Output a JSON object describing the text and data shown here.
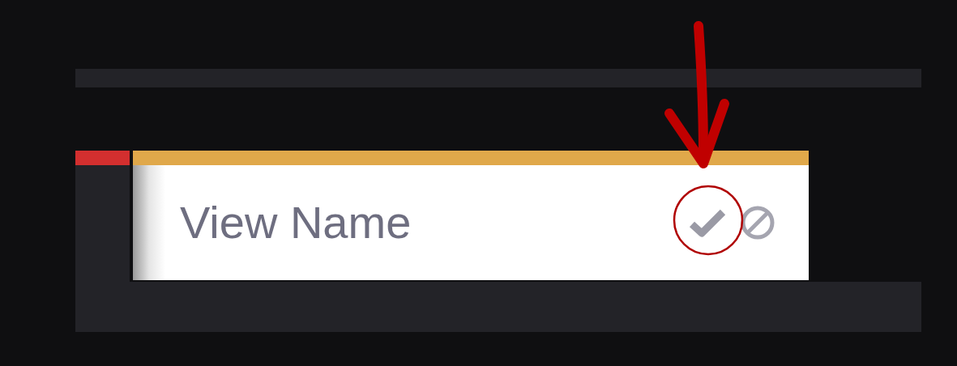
{
  "field": {
    "value": "View Name"
  }
}
